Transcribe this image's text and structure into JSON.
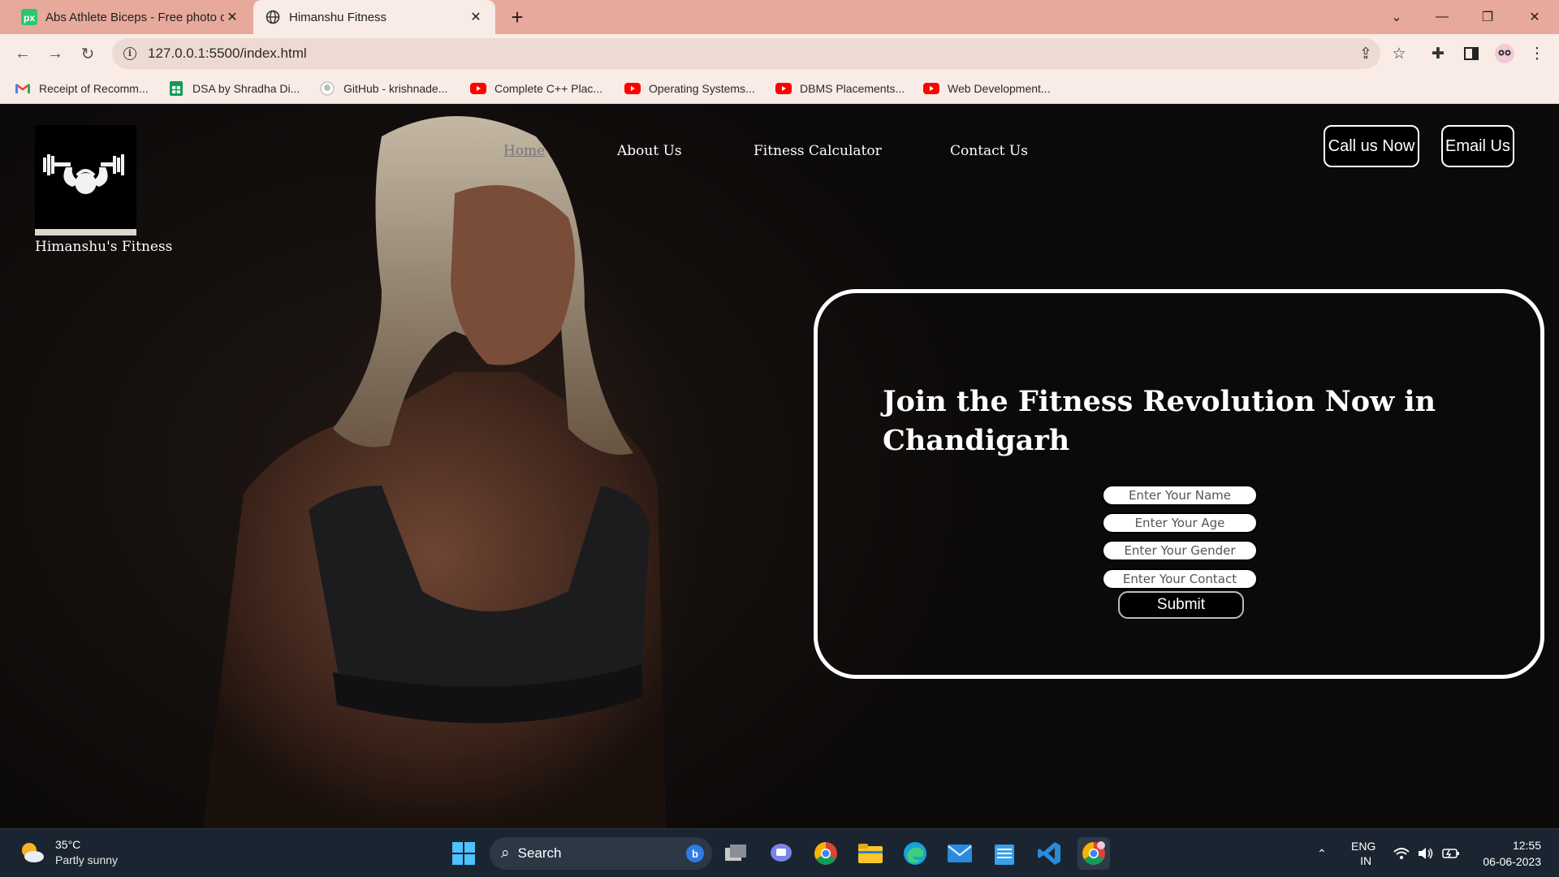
{
  "browser": {
    "tabs": [
      {
        "title": "Abs Athlete Biceps - Free photo on",
        "favicon": "pixabay-icon",
        "active": false
      },
      {
        "title": "Himanshu Fitness",
        "favicon": "globe-icon",
        "active": true
      }
    ],
    "url": "127.0.0.1:5500/index.html",
    "bookmarks": [
      {
        "label": "Receipt of Recomm...",
        "icon": "gmail-icon"
      },
      {
        "label": "DSA by Shradha Di...",
        "icon": "sheets-icon"
      },
      {
        "label": "GitHub - krishnade...",
        "icon": "github-icon"
      },
      {
        "label": "Complete C++ Plac...",
        "icon": "youtube-icon"
      },
      {
        "label": "Operating Systems...",
        "icon": "youtube-icon"
      },
      {
        "label": "DBMS Placements...",
        "icon": "youtube-icon"
      },
      {
        "label": "Web Development...",
        "icon": "youtube-icon"
      }
    ]
  },
  "site": {
    "brand": "Himanshu's Fitness",
    "nav": [
      "Home",
      "About Us",
      "Fitness Calculator",
      "Contact Us"
    ],
    "cta": {
      "call": "Call us Now",
      "email": "Email Us"
    },
    "form": {
      "heading": "Join the Fitness Revolution Now in Chandigarh",
      "placeholders": {
        "name": "Enter Your Name",
        "age": "Enter Your Age",
        "gender": "Enter Your Gender",
        "contact": "Enter Your Contact"
      },
      "submit": "Submit"
    }
  },
  "taskbar": {
    "weather": {
      "temp": "35°C",
      "condition": "Partly sunny"
    },
    "search_label": "Search",
    "lang": [
      "ENG",
      "IN"
    ],
    "time": "12:55",
    "date": "06-06-2023"
  },
  "colors": {
    "tabbar": "#e6a99b",
    "toolbar": "#f9ebe5",
    "page_bg": "#0c0a09",
    "taskbar": "#1b2531"
  }
}
